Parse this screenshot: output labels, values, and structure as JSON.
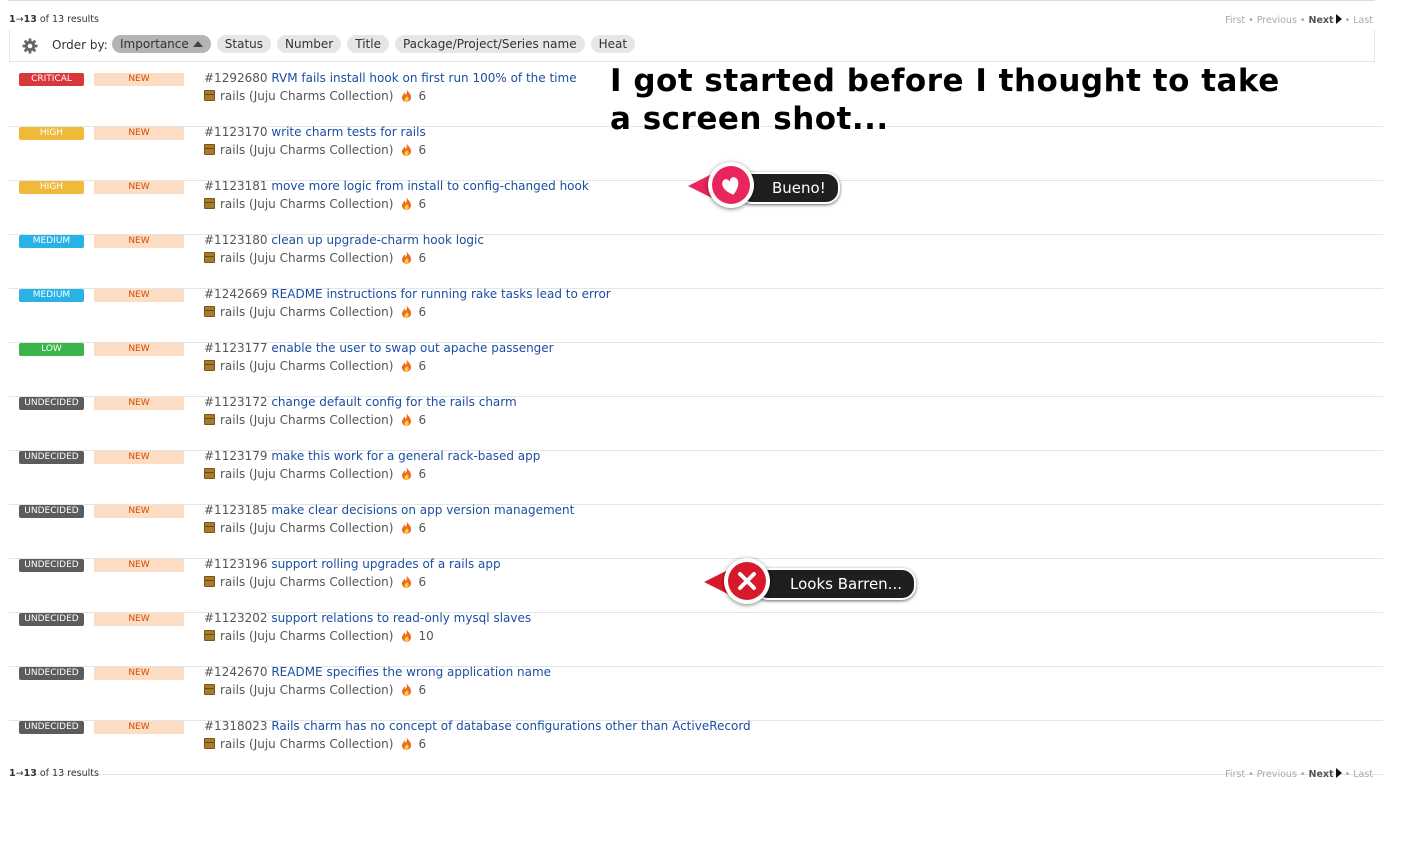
{
  "pager_top": {
    "first": "1",
    "arrow": "→",
    "last": "13",
    "of_text": "of 13 results",
    "nav": {
      "first": "First",
      "previous": "Previous",
      "next": "Next",
      "last": "Last"
    }
  },
  "pager_bottom": {
    "first": "1",
    "arrow": "→",
    "last": "13",
    "of_text": "of 13 results",
    "nav": {
      "first": "First",
      "previous": "Previous",
      "next": "Next",
      "last": "Last"
    }
  },
  "order": {
    "label": "Order by:",
    "options": [
      "Importance",
      "Status",
      "Number",
      "Title",
      "Package/Project/Series name",
      "Heat"
    ],
    "active": "Importance"
  },
  "importance_colors": {
    "CRITICAL": "#d9383a",
    "HIGH": "#f0b93a",
    "MEDIUM": "#29b2e6",
    "LOW": "#38b44a",
    "UNDECIDED": "#5c5c5c"
  },
  "bugs": [
    {
      "importance": "CRITICAL",
      "status": "NEW",
      "number": "#1292680",
      "title": "RVM fails install hook on first run 100% of the time",
      "package": "rails (Juju Charms Collection)",
      "heat": "6"
    },
    {
      "importance": "HIGH",
      "status": "NEW",
      "number": "#1123170",
      "title": "write charm tests for rails",
      "package": "rails (Juju Charms Collection)",
      "heat": "6"
    },
    {
      "importance": "HIGH",
      "status": "NEW",
      "number": "#1123181",
      "title": "move more logic from install to config-changed hook",
      "package": "rails (Juju Charms Collection)",
      "heat": "6"
    },
    {
      "importance": "MEDIUM",
      "status": "NEW",
      "number": "#1123180",
      "title": "clean up upgrade-charm hook logic",
      "package": "rails (Juju Charms Collection)",
      "heat": "6"
    },
    {
      "importance": "MEDIUM",
      "status": "NEW",
      "number": "#1242669",
      "title": "README instructions for running rake tasks lead to error",
      "package": "rails (Juju Charms Collection)",
      "heat": "6"
    },
    {
      "importance": "LOW",
      "status": "NEW",
      "number": "#1123177",
      "title": "enable the user to swap out apache passenger",
      "package": "rails (Juju Charms Collection)",
      "heat": "6"
    },
    {
      "importance": "UNDECIDED",
      "status": "NEW",
      "number": "#1123172",
      "title": "change default config for the rails charm",
      "package": "rails (Juju Charms Collection)",
      "heat": "6"
    },
    {
      "importance": "UNDECIDED",
      "status": "NEW",
      "number": "#1123179",
      "title": "make this work for a general rack-based app",
      "package": "rails (Juju Charms Collection)",
      "heat": "6"
    },
    {
      "importance": "UNDECIDED",
      "status": "NEW",
      "number": "#1123185",
      "title": "make clear decisions on app version management",
      "package": "rails (Juju Charms Collection)",
      "heat": "6"
    },
    {
      "importance": "UNDECIDED",
      "status": "NEW",
      "number": "#1123196",
      "title": "support rolling upgrades of a rails app",
      "package": "rails (Juju Charms Collection)",
      "heat": "6"
    },
    {
      "importance": "UNDECIDED",
      "status": "NEW",
      "number": "#1123202",
      "title": "support relations to read-only mysql slaves",
      "package": "rails (Juju Charms Collection)",
      "heat": "10"
    },
    {
      "importance": "UNDECIDED",
      "status": "NEW",
      "number": "#1242670",
      "title": "README specifies the wrong application name",
      "package": "rails (Juju Charms Collection)",
      "heat": "6"
    },
    {
      "importance": "UNDECIDED",
      "status": "NEW",
      "number": "#1318023",
      "title": "Rails charm has no concept of database configurations other than ActiveRecord",
      "package": "rails (Juju Charms Collection)",
      "heat": "6"
    }
  ],
  "annotation": {
    "caption_line1": "I got started before I thought to take",
    "caption_line2": "a screen shot...",
    "badge_good": "Bueno!",
    "badge_bad": "Looks Barren...",
    "good_color": "#e8265d",
    "bad_color": "#d8192b"
  }
}
